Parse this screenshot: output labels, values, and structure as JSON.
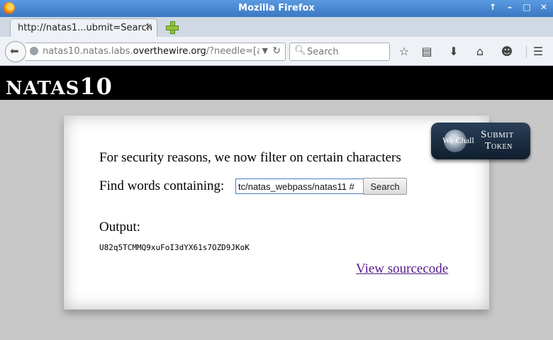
{
  "window": {
    "title": "Mozilla Firefox",
    "controls": [
      "↑",
      "–",
      "□",
      "✕"
    ]
  },
  "tab": {
    "title": "http://natas1...ubmit=Search",
    "close": "✕"
  },
  "nav": {
    "url_prefix": "natas10.natas.labs.",
    "url_domain": "overthewire.org",
    "url_suffix": "/?needle=[a-z]+",
    "search_placeholder": "Search"
  },
  "page": {
    "header_prefix": "NATAS",
    "header_number": "10",
    "filter_notice": "For security reasons, we now filter on certain characters",
    "find_label": "Find words containing:",
    "needle_value": "tc/natas_webpass/natas11 #",
    "search_button": "Search",
    "output_label": "Output:",
    "output_value": "U82q5TCMMQ9xuFoI3dYX61s7OZD9JKoK",
    "view_source": "View sourcecode"
  },
  "token_badge": {
    "brand": "We Chall",
    "line1": "Submit",
    "line2": "Token"
  }
}
